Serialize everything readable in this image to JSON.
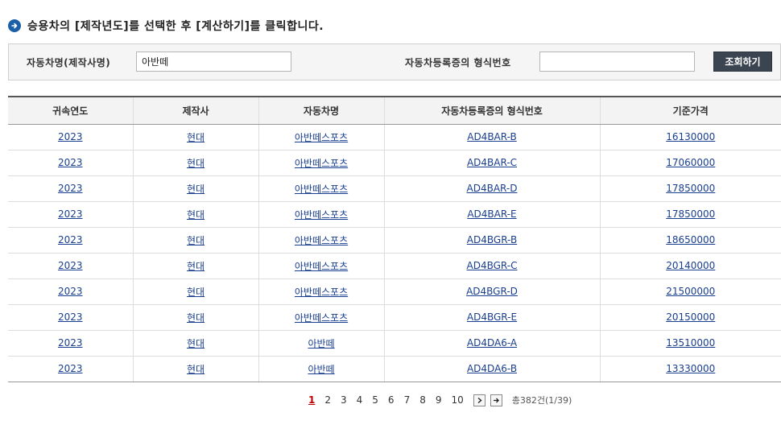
{
  "instruction": {
    "text": "승용차의 [제작년도]를 선택한 후 [계산하기]를 클릭합니다."
  },
  "search": {
    "name_label": "자동차명(제작사명)",
    "name_value": "아반떼",
    "type_label": "자동차등록증의 형식번호",
    "type_value": "",
    "button_label": "조회하기"
  },
  "table": {
    "headers": [
      "귀속연도",
      "제작사",
      "자동차명",
      "자동차등록증의 형식번호",
      "기준가격"
    ],
    "rows": [
      [
        "2023",
        "현대",
        "아반떼스포츠",
        "AD4BAR-B",
        "16130000"
      ],
      [
        "2023",
        "현대",
        "아반떼스포츠",
        "AD4BAR-C",
        "17060000"
      ],
      [
        "2023",
        "현대",
        "아반떼스포츠",
        "AD4BAR-D",
        "17850000"
      ],
      [
        "2023",
        "현대",
        "아반떼스포츠",
        "AD4BAR-E",
        "17850000"
      ],
      [
        "2023",
        "현대",
        "아반떼스포츠",
        "AD4BGR-B",
        "18650000"
      ],
      [
        "2023",
        "현대",
        "아반떼스포츠",
        "AD4BGR-C",
        "20140000"
      ],
      [
        "2023",
        "현대",
        "아반떼스포츠",
        "AD4BGR-D",
        "21500000"
      ],
      [
        "2023",
        "현대",
        "아반떼스포츠",
        "AD4BGR-E",
        "20150000"
      ],
      [
        "2023",
        "현대",
        "아반떼",
        "AD4DA6-A",
        "13510000"
      ],
      [
        "2023",
        "현대",
        "아반떼",
        "AD4DA6-B",
        "13330000"
      ]
    ]
  },
  "pagination": {
    "pages": [
      "1",
      "2",
      "3",
      "4",
      "5",
      "6",
      "7",
      "8",
      "9",
      "10"
    ],
    "current": "1",
    "next_icon": "next-page-icon",
    "last_icon": "last-page-icon",
    "total": "총382건(1/39)"
  },
  "colors": {
    "accent": "#1a5fa8",
    "button": "#3b4552",
    "link": "#1a3f8e",
    "current_page": "#c00000"
  }
}
